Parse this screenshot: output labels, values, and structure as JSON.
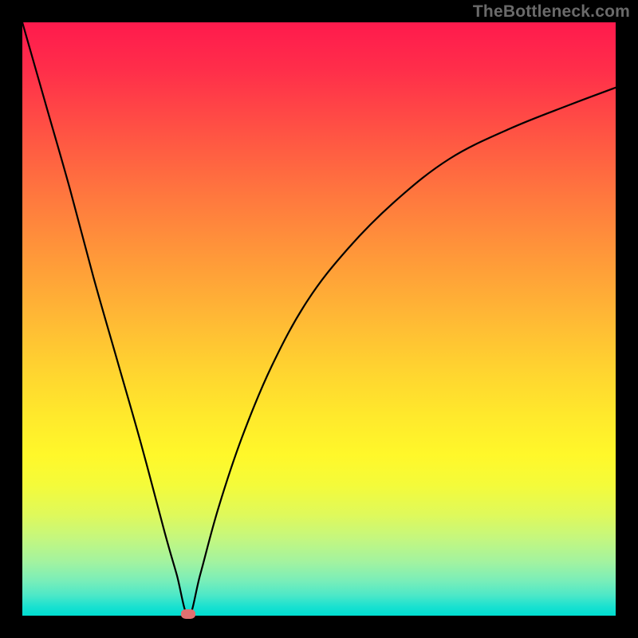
{
  "watermark": "TheBottleneck.com",
  "chart_data": {
    "type": "line",
    "title": "",
    "xlabel": "",
    "ylabel": "",
    "xlim": [
      0,
      100
    ],
    "ylim": [
      0,
      100
    ],
    "min_point": {
      "x": 28,
      "y": 0
    },
    "series": [
      {
        "name": "bottleneck-curve",
        "x": [
          0,
          4,
          8,
          12,
          16,
          20,
          24,
          26,
          28,
          30,
          33,
          37,
          42,
          48,
          55,
          63,
          72,
          82,
          92,
          100
        ],
        "y": [
          100,
          86,
          72,
          57,
          43,
          29,
          14,
          7,
          0,
          7,
          18,
          30,
          42,
          53,
          62,
          70,
          77,
          82,
          86,
          89
        ]
      }
    ],
    "marker": {
      "x": 28,
      "y": 0,
      "color": "#e17070"
    },
    "background_gradient": {
      "top": "#ff1a4d",
      "mid_upper": "#ffb935",
      "mid_lower": "#fff82a",
      "bottom": "#00ddd0"
    }
  }
}
